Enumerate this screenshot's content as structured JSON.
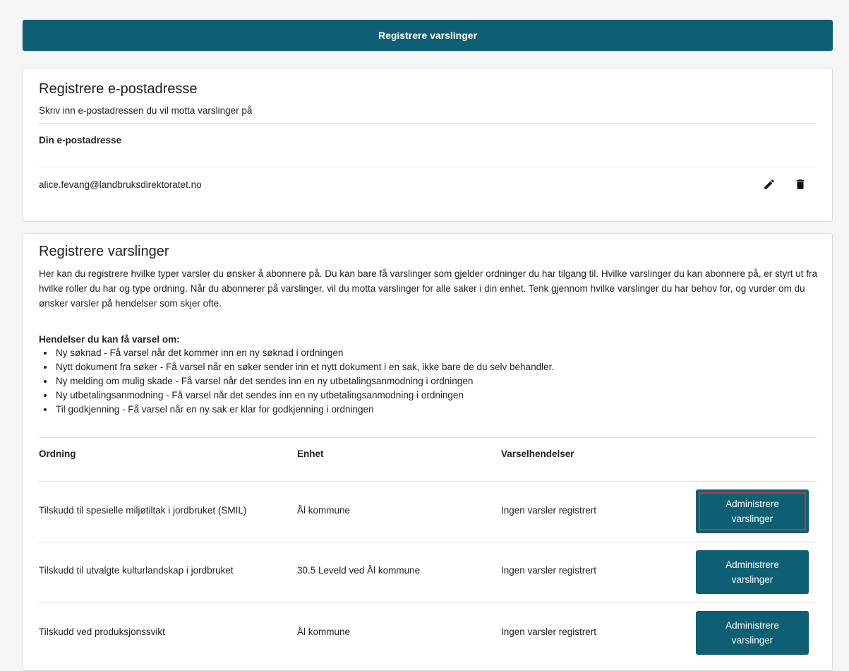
{
  "banner": {
    "label": "Registrere varslinger"
  },
  "email_section": {
    "title": "Registrere e-postadresse",
    "subtitle": "Skriv inn e-postadressen du vil motta varslinger på",
    "column_header": "Din e-postadresse",
    "email": "alice.fevang@landbruksdirektoratet.no",
    "actions": [
      "pencil-icon",
      "trash-icon"
    ]
  },
  "notifications_section": {
    "title": "Registrere varslinger",
    "description": "Her kan du registrere hvilke typer varsler du ønsker å abonnere på. Du kan bare få varslinger som gjelder ordninger du har tilgang til. Hvilke varslinger du kan abonnere på, er styrt ut fra hvilke roller du har og type ordning. Når du abonnerer på varslinger, vil du motta varslinger for alle saker i din enhet. Tenk gjennom hvilke varslinger du har behov for, og vurder om du ønsker varsler på hendelser som skjer ofte.",
    "events_heading": "Hendelser du kan få varsel om:",
    "events": [
      "Ny søknad - Få varsel når det kommer inn en ny søknad i ordningen",
      "Nytt dokument fra søker - Få varsel når en søker sender inn et nytt dokument i en sak, ikke bare de du selv behandler.",
      "Ny melding om mulig skade - Få varsel når det sendes inn en ny utbetalingsanmodning i ordningen",
      "Ny utbetalingsanmodning - Få varsel når det sendes inn en ny utbetalingsanmodning i ordningen",
      "Til godkjenning - Få varsel når en ny sak er klar for godkjenning i ordningen"
    ],
    "table": {
      "headers": [
        "Ordning",
        "Enhet",
        "Varselhendelser"
      ],
      "rows": [
        {
          "ordning": "Tilskudd til spesielle miljøtiltak i jordbruket (SMIL)",
          "enhet": "Ål kommune",
          "varsler": "Ingen varsler registrert",
          "button": "Administrere varslinger"
        },
        {
          "ordning": "Tilskudd til utvalgte kulturlandskap i jordbruket",
          "enhet": "30.5 Leveld ved Ål kommune",
          "varsler": "Ingen varsler registrert",
          "button": "Administrere varslinger"
        },
        {
          "ordning": "Tilskudd ved produksjonssvikt",
          "enhet": "Ål kommune",
          "varsler": "Ingen varsler registrert",
          "button": "Administrere varslinger"
        }
      ]
    }
  },
  "colors": {
    "primary": "#0f5f74",
    "focus_outline": "#c0392b"
  }
}
